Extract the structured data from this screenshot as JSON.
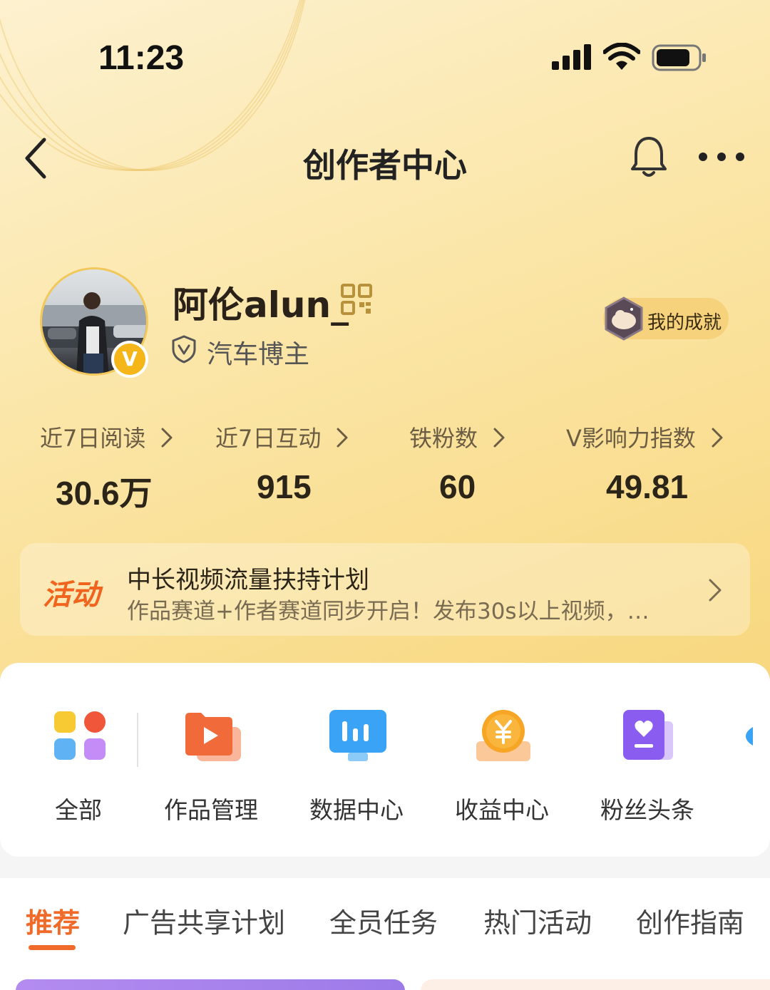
{
  "status_bar": {
    "time": "11:23",
    "icons": [
      "signal-icon",
      "wifi-icon",
      "battery-icon"
    ]
  },
  "nav": {
    "title": "创作者中心",
    "back_icon": "chevron-left-icon",
    "bell_icon": "bell-icon",
    "more_icon": "more-icon"
  },
  "profile": {
    "username": "阿伦alun_",
    "role": "汽车博主",
    "verified_badge": "V",
    "achievement_label": "我的成就"
  },
  "stats": [
    {
      "label": "近7日阅读",
      "value": "30.6万"
    },
    {
      "label": "近7日互动",
      "value": "915"
    },
    {
      "label": "铁粉数",
      "value": "60"
    },
    {
      "label": "V影响力指数",
      "value": "49.81"
    }
  ],
  "activity": {
    "tag": "活动",
    "title": "中长视频流量扶持计划",
    "description": "作品赛道+作者赛道同步开启！发布30s以上视频，…"
  },
  "tools": [
    {
      "label": "全部",
      "icon": "grid-apps-icon"
    },
    {
      "label": "作品管理",
      "icon": "video-folder-icon"
    },
    {
      "label": "数据中心",
      "icon": "chart-monitor-icon"
    },
    {
      "label": "收益中心",
      "icon": "yen-coin-icon"
    },
    {
      "label": "粉丝头条",
      "icon": "heart-book-icon"
    }
  ],
  "tabs": [
    {
      "label": "推荐",
      "active": true
    },
    {
      "label": "广告共享计划",
      "active": false
    },
    {
      "label": "全员任务",
      "active": false
    },
    {
      "label": "热门活动",
      "active": false
    },
    {
      "label": "创作指南",
      "active": false
    }
  ],
  "colors": {
    "accent": "#f06a2a",
    "header_gradient_start": "#fdf1cf",
    "header_gradient_end": "#f8d77e",
    "verified": "#f4b619"
  }
}
